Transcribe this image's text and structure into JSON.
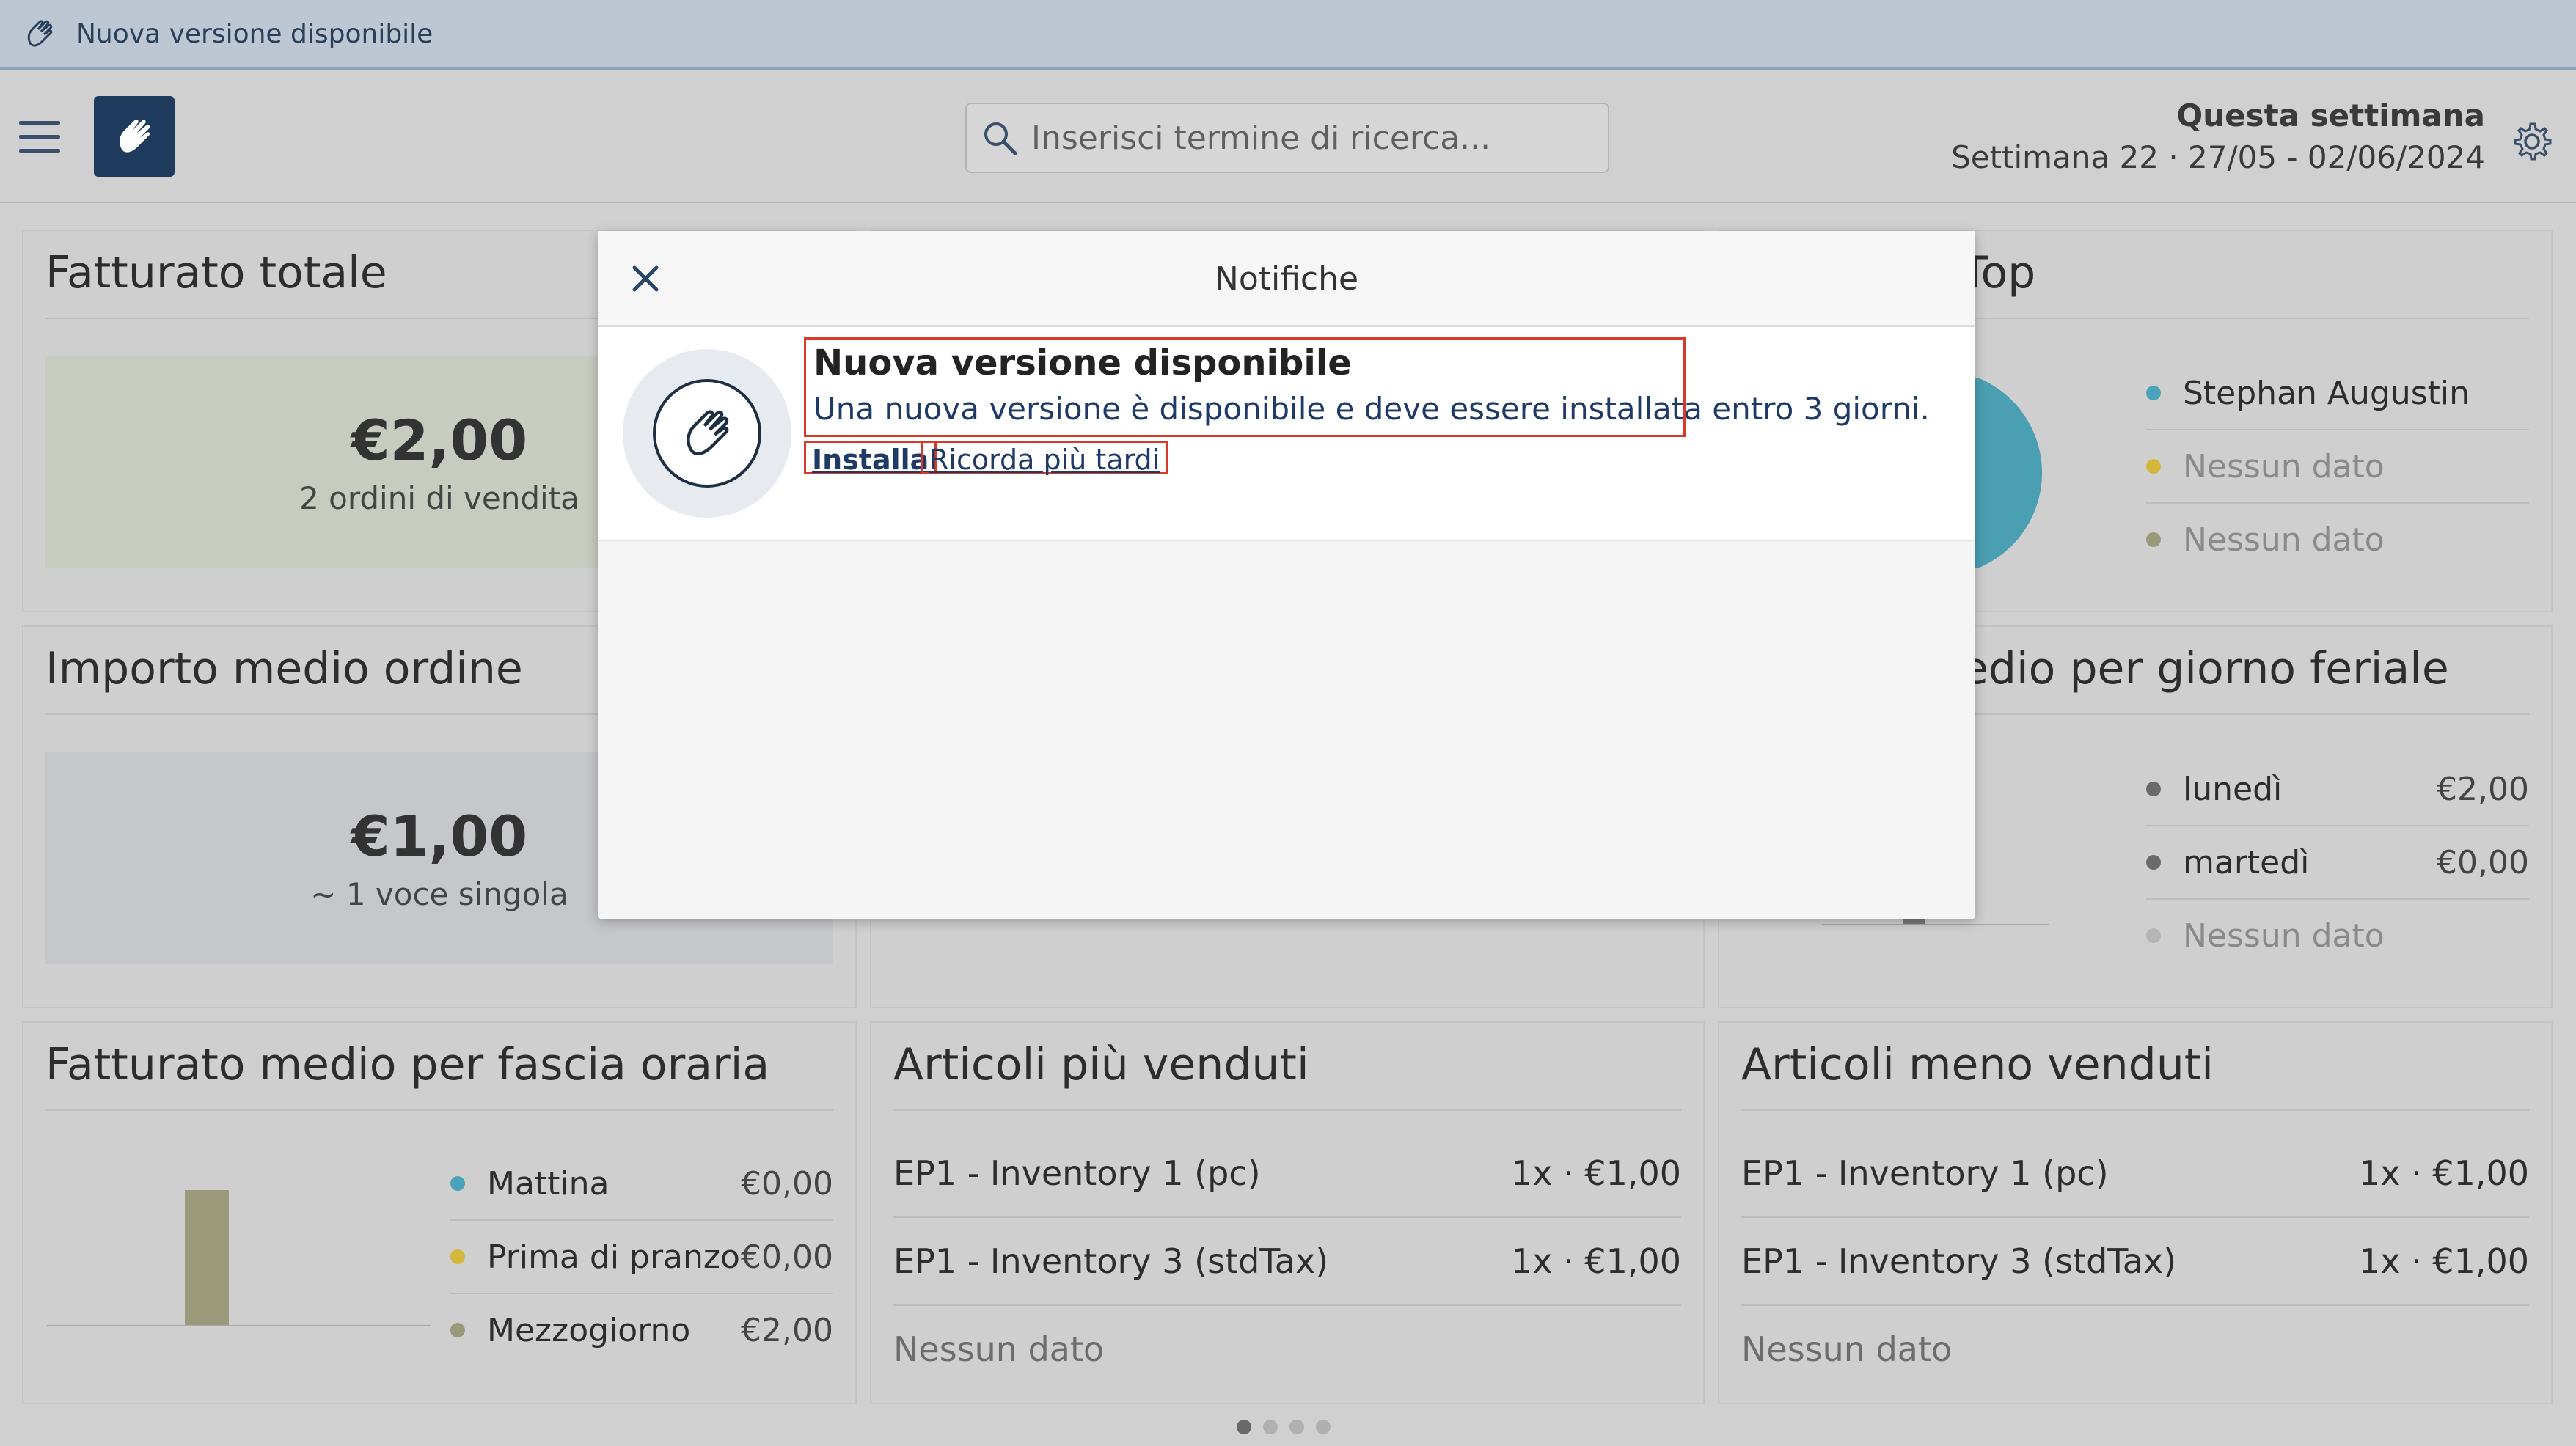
{
  "banner": {
    "text": "Nuova versione disponibile",
    "icon": "hand-icon"
  },
  "header": {
    "search_placeholder": "Inserisci termine di ricerca...",
    "week_title": "Questa settimana",
    "week_range": "Settimana 22 · 27/05 - 02/06/2024"
  },
  "cards": {
    "total_revenue": {
      "title": "Fatturato totale",
      "value": "€2,00",
      "sub": "2 ordini di vendita"
    },
    "top": {
      "title": "Top",
      "items": [
        {
          "name": "Stephan Augustin",
          "color": "#4aa3b9"
        },
        {
          "name": "Nessun dato",
          "color": "#d4b83c"
        },
        {
          "name": "Nessun dato",
          "color": "#9a9a7a"
        }
      ]
    },
    "avg_order": {
      "title": "Importo medio ordine",
      "value": "€1,00",
      "sub": "~ 1 voce singola"
    },
    "weekday": {
      "title": "edio per giorno feriale",
      "items": [
        {
          "name": "lunedì",
          "value": "€2,00"
        },
        {
          "name": "martedì",
          "value": "€0,00"
        },
        {
          "name": "Nessun dato",
          "value": ""
        }
      ]
    },
    "hourly": {
      "title": "Fatturato medio per fascia oraria",
      "items": [
        {
          "name": "Mattina",
          "value": "€0,00",
          "color": "#4aa3b9"
        },
        {
          "name": "Prima di pranzo",
          "value": "€0,00",
          "color": "#d4b83c"
        },
        {
          "name": "Mezzogiorno",
          "value": "€2,00",
          "color": "#9a9a7a"
        }
      ]
    },
    "best": {
      "title": "Articoli più venduti",
      "items": [
        {
          "name": "EP1 - Inventory 1 (pc)",
          "value": "1x · €1,00"
        },
        {
          "name": "EP1 - Inventory 3 (stdTax)",
          "value": "1x · €1,00"
        },
        {
          "name": "Nessun dato",
          "value": ""
        }
      ]
    },
    "worst": {
      "title": "Articoli meno venduti",
      "items": [
        {
          "name": "EP1 - Inventory 1 (pc)",
          "value": "1x · €1,00"
        },
        {
          "name": "EP1 - Inventory 3 (stdTax)",
          "value": "1x · €1,00"
        },
        {
          "name": "Nessun dato",
          "value": ""
        }
      ]
    }
  },
  "modal": {
    "title": "Notifiche",
    "notification": {
      "title": "Nuova versione disponibile",
      "text": "Una nuova versione è disponibile e deve essere installata entro 3 giorni.",
      "install_label": "Installa",
      "later_label": "Ricorda più tardi"
    }
  },
  "colors": {
    "brand": "#1e3a5c",
    "highlight": "#d83a2a",
    "link": "#1f3a66"
  }
}
